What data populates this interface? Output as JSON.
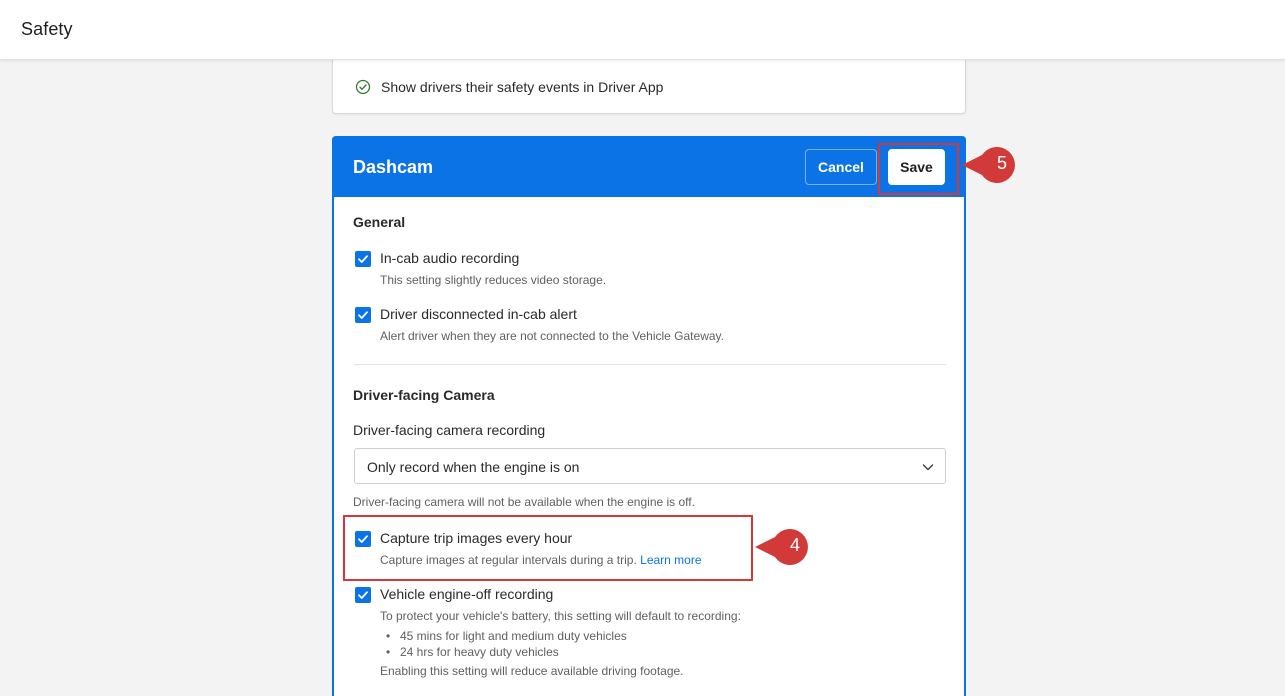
{
  "topbar": {
    "title": "Safety"
  },
  "previous_card": {
    "item_label": "Show drivers their safety events in Driver App"
  },
  "dashcam": {
    "title": "Dashcam",
    "cancel_label": "Cancel",
    "save_label": "Save",
    "general": {
      "title": "General",
      "items": [
        {
          "label": "In-cab audio recording",
          "description": "This setting slightly reduces video storage.",
          "checked": true
        },
        {
          "label": "Driver disconnected in-cab alert",
          "description": "Alert driver when they are not connected to the Vehicle Gateway.",
          "checked": true
        }
      ]
    },
    "driver_facing": {
      "title": "Driver-facing Camera",
      "recording_label": "Driver-facing camera recording",
      "recording_value": "Only record when the engine is on",
      "recording_help": "Driver-facing camera will not be available when the engine is off.",
      "trip_images": {
        "label": "Capture trip images every hour",
        "description": "Capture images at regular intervals during a trip.",
        "link": "Learn more",
        "checked": true
      },
      "engine_off": {
        "label": "Vehicle engine-off recording",
        "description": "To protect your vehicle's battery, this setting will default to recording:",
        "bullets": [
          "45 mins for light and medium duty vehicles",
          "24 hrs for heavy duty vehicles"
        ],
        "footnote": "Enabling this setting will reduce available driving footage.",
        "checked": true
      }
    }
  },
  "annotations": {
    "step_4": "4",
    "step_5": "5",
    "color": "#d23a3a"
  },
  "colors": {
    "primary": "#0b73e6",
    "success": "#2e7d32"
  }
}
